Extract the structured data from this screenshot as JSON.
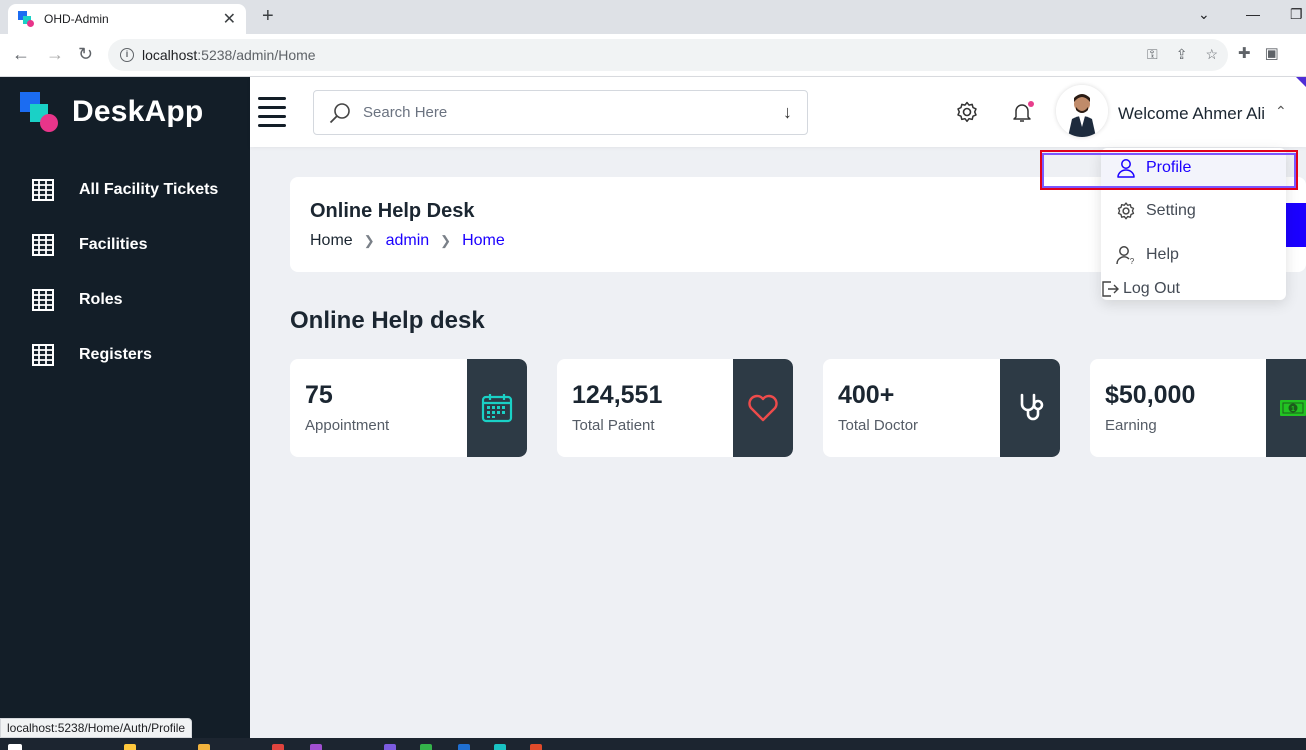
{
  "browser": {
    "tab_title": "OHD-Admin",
    "tab_close": "✕",
    "new_tab": "+",
    "url_host": "localhost",
    "url_path": ":5238/admin/Home",
    "status_url": "localhost:5238/Home/Auth/Profile"
  },
  "sidebar": {
    "logo_text": "DeskApp",
    "items": [
      {
        "label": "All Facility Tickets",
        "icon": "table-icon"
      },
      {
        "label": "Facilities",
        "icon": "table-icon"
      },
      {
        "label": "Roles",
        "icon": "table-icon"
      },
      {
        "label": "Registers",
        "icon": "table-icon"
      }
    ]
  },
  "header": {
    "search_placeholder": "Search Here",
    "welcome": "Welcome Ahmer Ali"
  },
  "user_menu": {
    "items": [
      {
        "label": "Profile",
        "icon": "user-icon",
        "active": true
      },
      {
        "label": "Setting",
        "icon": "gear-icon"
      },
      {
        "label": "Help",
        "icon": "help-user-icon"
      },
      {
        "label": "Log Out",
        "icon": "logout-icon"
      }
    ]
  },
  "page": {
    "card_title": "Online Help Desk",
    "breadcrumb": [
      "Home",
      "admin",
      "Home"
    ],
    "section_title": "Online Help desk"
  },
  "stats": [
    {
      "value": "75",
      "label": "Appointment",
      "icon": "calendar-icon",
      "icon_color": "#1ad1c6"
    },
    {
      "value": "124,551",
      "label": "Total Patient",
      "icon": "heart-icon",
      "icon_color": "#ee4b4b"
    },
    {
      "value": "400+",
      "label": "Total Doctor",
      "icon": "stethoscope-icon",
      "icon_color": "#ffffff"
    },
    {
      "value": "$50,000",
      "label": "Earning",
      "icon": "money-icon",
      "icon_color": "#22c322"
    }
  ],
  "colors": {
    "sidebar_bg": "#131e28",
    "accent": "#1b00ff",
    "icon_box": "#2d3a45"
  }
}
